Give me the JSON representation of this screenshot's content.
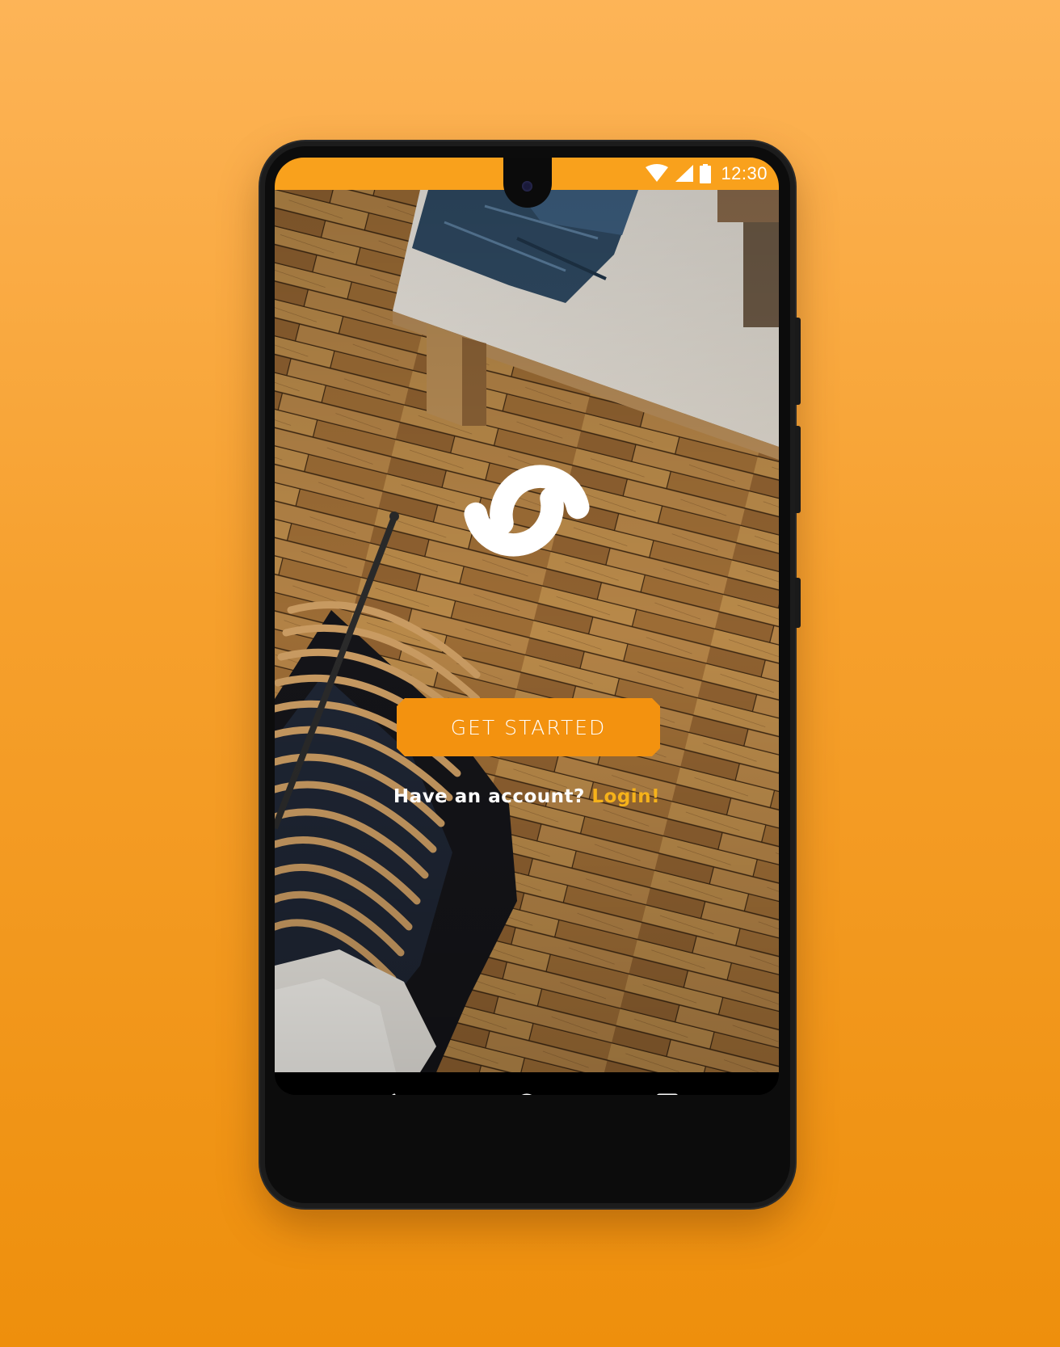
{
  "status_bar": {
    "time": "12:30",
    "icons": [
      "wifi-icon",
      "cellular-signal-icon",
      "battery-icon"
    ],
    "color": "#f9a11c"
  },
  "app": {
    "logo_icon": "link-logo-icon",
    "cta_label": "GET STARTED",
    "login_prompt": "Have an account?",
    "login_link": "Login!"
  },
  "nav_bar": {
    "icons": [
      "back-icon",
      "home-icon",
      "recent-apps-icon"
    ]
  },
  "colors": {
    "accent": "#f3920f",
    "login_link": "#f6b21a",
    "background_top": "#fdb457",
    "background_bottom": "#ee8f0c"
  }
}
